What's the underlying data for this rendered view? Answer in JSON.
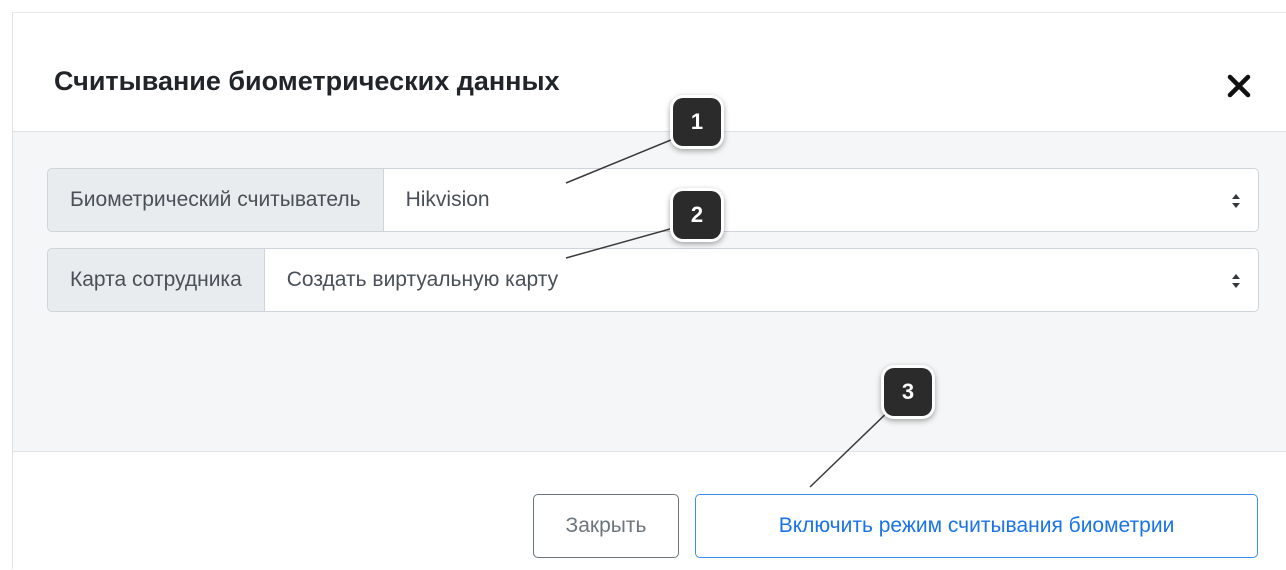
{
  "dialog": {
    "title": "Считывание биометрических данных",
    "close_icon": "close-icon"
  },
  "fields": {
    "reader": {
      "label": "Биометрический считыватель",
      "value": "Hikvision"
    },
    "card": {
      "label": "Карта сотрудника",
      "value": "Создать виртуальную карту"
    }
  },
  "footer": {
    "close_label": "Закрыть",
    "enable_label": "Включить режим считывания биометрии"
  },
  "callouts": [
    "1",
    "2",
    "3"
  ],
  "colors": {
    "primary": "#1a73e8",
    "primary_border": "#3b8ef0",
    "secondary": "#6c757d",
    "callout_bg": "#2b2b2b",
    "body_bg": "#f5f6f7",
    "addon_bg": "#e9ecef"
  }
}
